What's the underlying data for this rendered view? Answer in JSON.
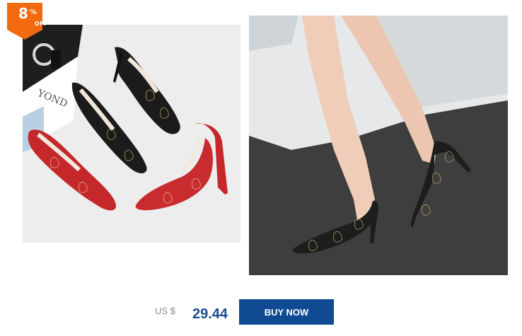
{
  "discount_badge": {
    "value": "8",
    "percent_sign": "%",
    "off_label": "OFF",
    "color": "#f26a10"
  },
  "product_images": [
    {
      "name": "photo-shoes-flatlay",
      "description_icon": "shoe-photo"
    },
    {
      "name": "photo-shoes-worn",
      "description_icon": "shoe-photo"
    }
  ],
  "pricing": {
    "currency_label": "US $",
    "price": "29.44"
  },
  "actions": {
    "buy_now_label": "BUY NOW",
    "button_color": "#0f4a92"
  }
}
